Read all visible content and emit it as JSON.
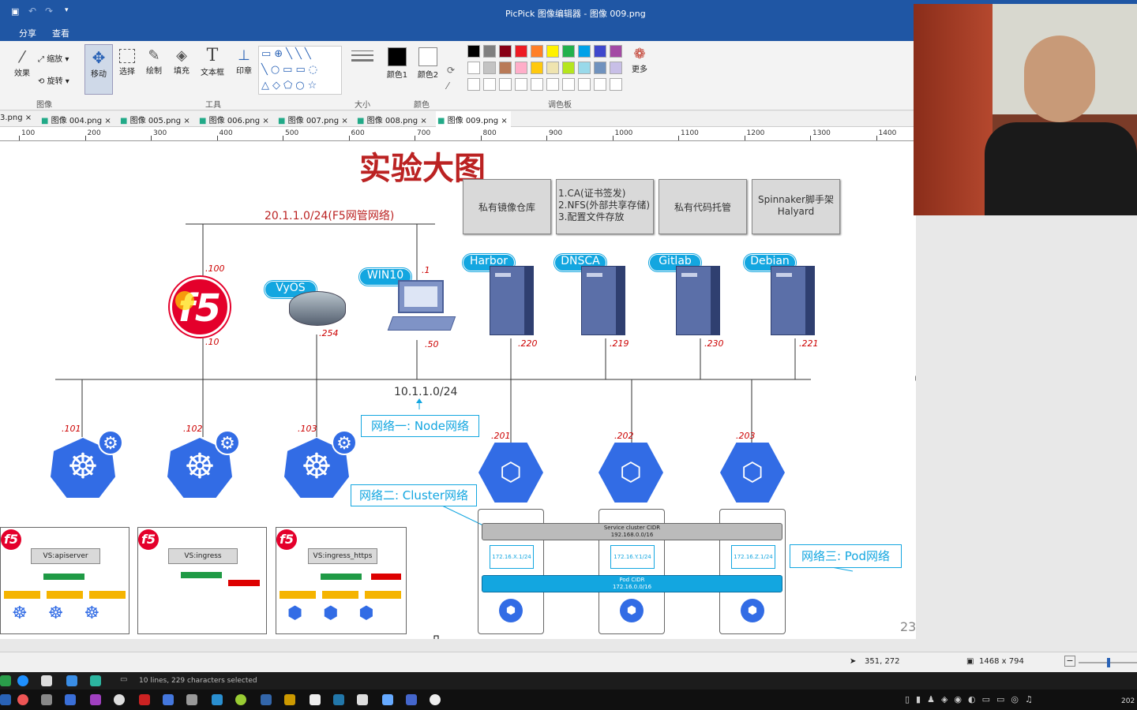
{
  "window": {
    "title": "PicPick 图像编辑器 - 图像 009.png"
  },
  "ribbon_tabs": [
    "分享",
    "查看"
  ],
  "ribbon": {
    "effect": "效果",
    "zoom": "缩放",
    "rotate": "旋转",
    "move": "移动",
    "select": "选择",
    "draw": "绘制",
    "fill": "填充",
    "textbox": "文本框",
    "stamp": "印章",
    "color1": "颜色1",
    "color2": "颜色2",
    "more": "更多",
    "group_image": "图像",
    "group_tools": "工具",
    "group_size": "大小",
    "group_color": "颜色",
    "group_palette": "调色板"
  },
  "palette": [
    "#000000",
    "#7f7f7f",
    "#880015",
    "#ed1c24",
    "#ff7f27",
    "#fff200",
    "#22b14c",
    "#00a2e8",
    "#3f48cc",
    "#a349a4",
    "#ffffff",
    "#c3c3c3",
    "#b97a57",
    "#ffaec9",
    "#ffc90e",
    "#efe4b0",
    "#b5e61d",
    "#99d9ea",
    "#7092be",
    "#c8bfe7"
  ],
  "doc_tabs": [
    "3.png",
    "图像 004.png",
    "图像 005.png",
    "图像 006.png",
    "图像 007.png",
    "图像 008.png",
    "图像 009.png"
  ],
  "ruler": [
    "100",
    "200",
    "300",
    "400",
    "500",
    "600",
    "700",
    "800",
    "900",
    "1000",
    "1100",
    "1200",
    "1300",
    "1400"
  ],
  "diagram": {
    "title": "实验大图",
    "mgmt_net": "20.1.1.0/24(F5网管网络)",
    "services": [
      "私有镜像仓库",
      "1.CA(证书签发)\n2.NFS(外部共享存储)\n3.配置文件存放",
      "私有代码托管",
      "Spinnaker脚手架\nHalyard"
    ],
    "hosts": [
      "Harbor",
      "DNSCA",
      "Gitlab",
      "Debian"
    ],
    "host_ips": [
      ".220",
      ".219",
      ".230",
      ".221"
    ],
    "vyos": "VyOS",
    "win10": "WIN10",
    "f5_ip_top": ".100",
    "f5_ip_bottom": ".10",
    "vyos_ip": ".254",
    "win10_ip_top": ".1",
    "win10_ip_bottom": ".50",
    "node_net": "10.1.1.0/24",
    "net1": "网络一: Node网络",
    "net2": "网络二: Cluster网络",
    "net3": "网络三: Pod网络",
    "masters": [
      ".101",
      ".102",
      ".103"
    ],
    "workers": [
      ".201",
      ".202",
      ".203"
    ],
    "vs": [
      "VS:apiserver",
      "VS:ingress",
      "VS:ingress_https"
    ],
    "cluster_cidr": "Service cluster CIDR\n192.168.0.0/16",
    "pod_cidr": "Pod CIDR\n172.16.0.0/16",
    "pod_subnets": [
      "172.16.X.1/24",
      "172.16.Y.1/24",
      "172.16.Z.1/24"
    ],
    "page_number": "23"
  },
  "status": {
    "cursor": "351, 272",
    "image_size": "1468 x 794",
    "selection_info": "10 lines, 229 characters selected"
  },
  "clock": "202"
}
